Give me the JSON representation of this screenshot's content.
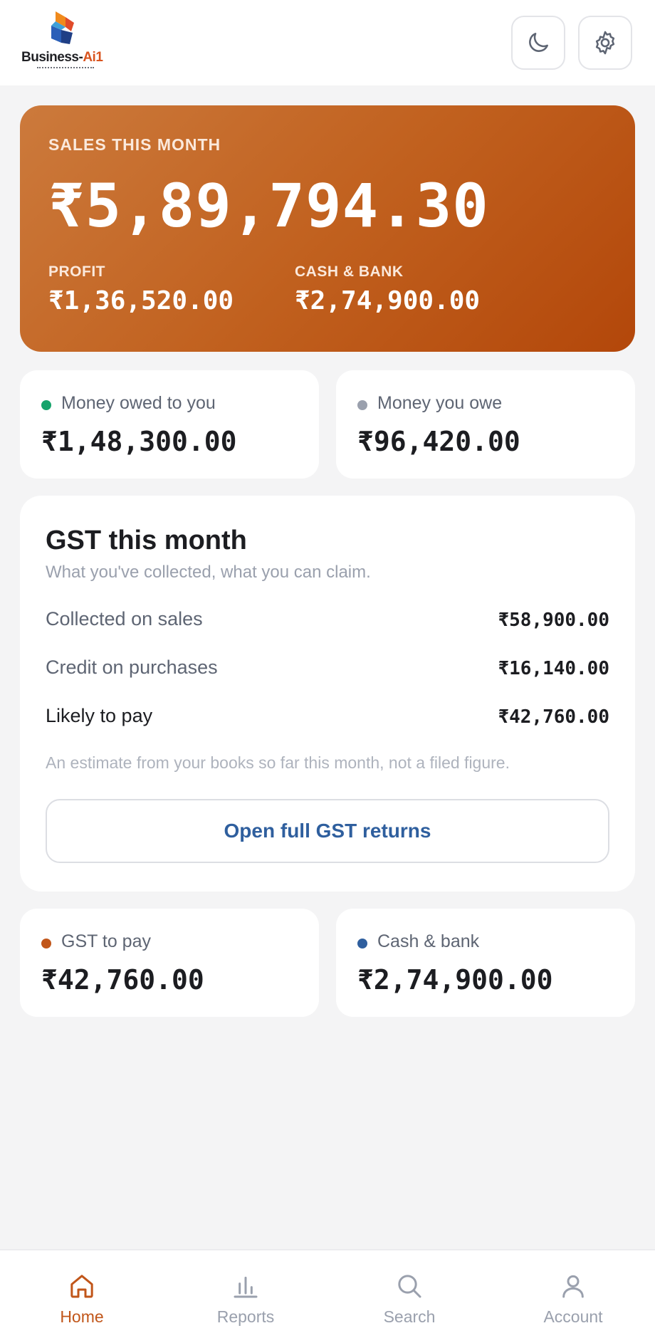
{
  "header": {
    "logo": {
      "name_main": "Business-",
      "name_accent": "Ai1"
    },
    "icons": {
      "theme": "moon-icon",
      "settings": "gear-icon"
    }
  },
  "hero": {
    "label": "SALES THIS MONTH",
    "value": "₹5,89,794.30",
    "profit_label": "PROFIT",
    "profit_value": "₹1,36,520.00",
    "cash_label": "CASH & BANK",
    "cash_value": "₹2,74,900.00"
  },
  "summary": {
    "owed_to_you": {
      "label": "Money owed to you",
      "value": "₹1,48,300.00",
      "dot_color": "#16a36b"
    },
    "you_owe": {
      "label": "Money you owe",
      "value": "₹96,420.00",
      "dot_color": "#9aa0ad"
    }
  },
  "gst": {
    "title": "GST this month",
    "subtitle": "What you've collected, what you can claim.",
    "rows": [
      {
        "label": "Collected on sales",
        "value": "₹58,900.00"
      },
      {
        "label": "Credit on purchases",
        "value": "₹16,140.00"
      },
      {
        "label": "Likely to pay",
        "value": "₹42,760.00"
      }
    ],
    "note": "An estimate from your books so far this month, not a filed figure.",
    "button_label": "Open full GST returns"
  },
  "bottom_cards": {
    "gst_to_pay": {
      "label": "GST to pay",
      "value": "₹42,760.00",
      "dot_color": "#c1561a"
    },
    "cash_bank": {
      "label": "Cash & bank",
      "value": "₹2,74,900.00",
      "dot_color": "#2f5f9e"
    }
  },
  "nav": {
    "items": [
      {
        "label": "Home",
        "icon": "home-icon",
        "active": true
      },
      {
        "label": "Reports",
        "icon": "bar-chart-icon",
        "active": false
      },
      {
        "label": "Search",
        "icon": "search-icon",
        "active": false
      },
      {
        "label": "Account",
        "icon": "user-icon",
        "active": false
      }
    ]
  },
  "colors": {
    "accent": "#c1561a",
    "link": "#2f5f9e",
    "background": "#f4f4f5"
  }
}
